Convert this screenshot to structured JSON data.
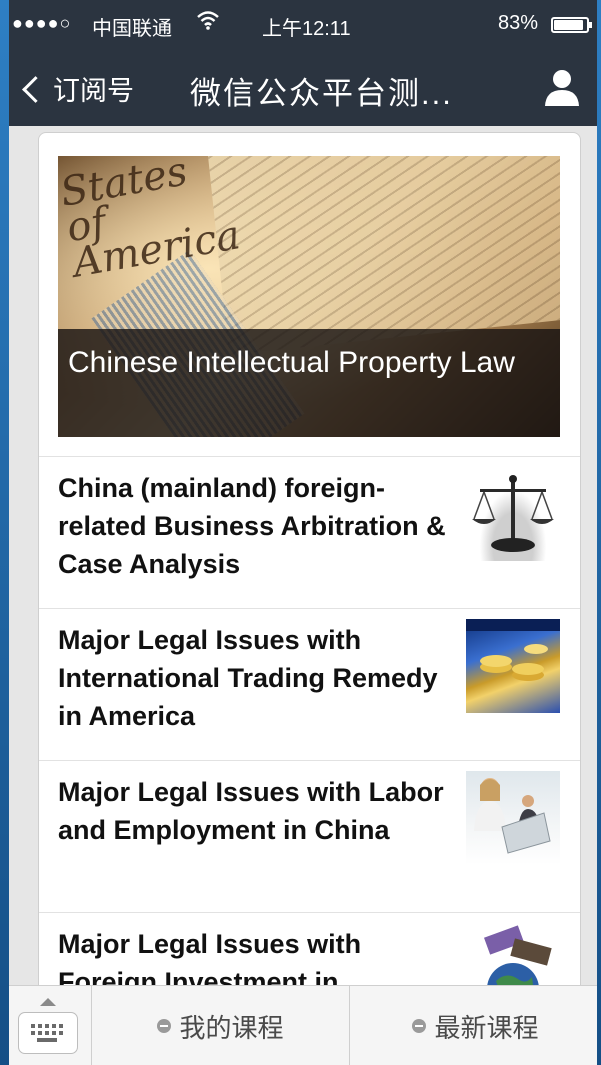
{
  "status": {
    "signal": "●●●●○",
    "carrier": "中国联通",
    "time": "上午12:11",
    "battery": "83%"
  },
  "nav": {
    "back_label": "订阅号",
    "title": "微信公众平台测..."
  },
  "hero": {
    "caption": "Chinese Intellectual Property Law",
    "image_script": "United States of America"
  },
  "articles": [
    {
      "title": "China (mainland) foreign-related Business Arbitration & Case Analysis",
      "thumb": "scales-of-justice"
    },
    {
      "title": "Major Legal Issues with International Trading Remedy in America",
      "thumb": "coins-chart"
    },
    {
      "title": "Major Legal Issues with Labor and Employment in China",
      "thumb": "office-workers"
    },
    {
      "title": "Major Legal Issues with Foreign Investment in",
      "thumb": "globe-banknotes"
    }
  ],
  "toolbar": {
    "menu1": "我的课程",
    "menu2": "最新课程"
  },
  "colors": {
    "navbar": "#2b3440",
    "background": "#e6e6e6"
  }
}
